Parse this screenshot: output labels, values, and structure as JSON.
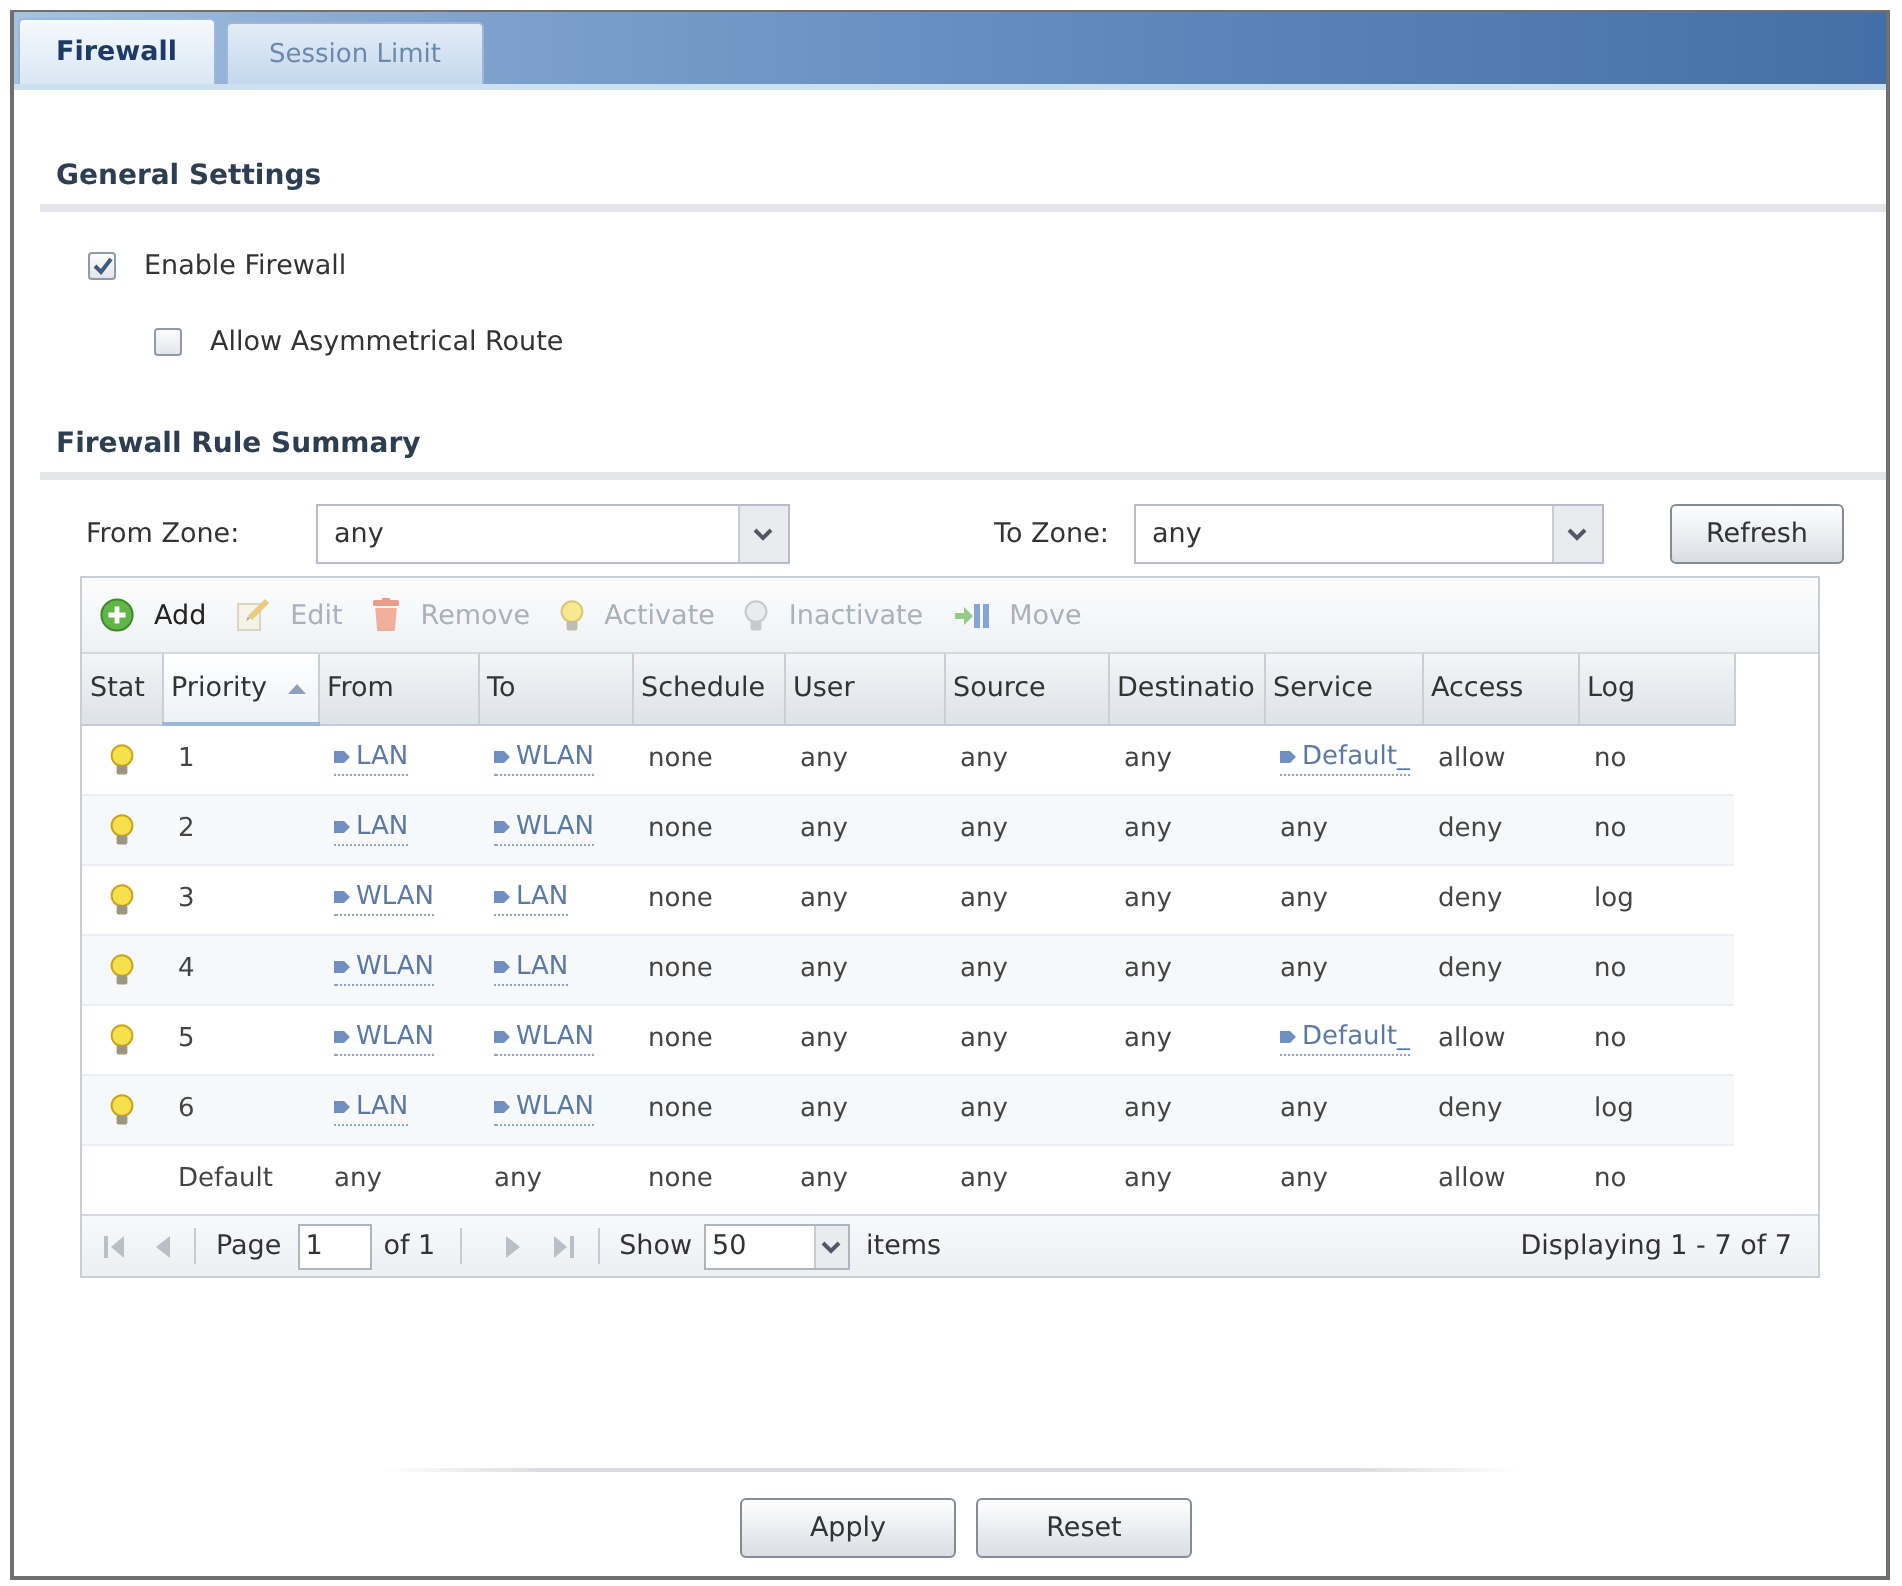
{
  "tabs": [
    {
      "label": "Firewall",
      "selected": true
    },
    {
      "label": "Session Limit",
      "selected": false
    }
  ],
  "general_settings": {
    "title": "General Settings",
    "options": [
      {
        "label": "Enable Firewall",
        "checked": true,
        "children": [
          {
            "label": "Allow Asymmetrical Route",
            "checked": false
          }
        ]
      }
    ]
  },
  "rule_summary": {
    "title": "Firewall Rule Summary",
    "from_zone": {
      "label": "From Zone:",
      "value": "any"
    },
    "to_zone": {
      "label": "To Zone:",
      "value": "any"
    },
    "refresh_button": "Refresh",
    "toolbar": [
      {
        "label": "Add",
        "disabled": false
      },
      {
        "label": "Edit",
        "disabled": true
      },
      {
        "label": "Remove",
        "disabled": true
      },
      {
        "label": "Activate",
        "disabled": true
      },
      {
        "label": "Inactivate",
        "disabled": true
      },
      {
        "label": "Move",
        "disabled": true
      }
    ],
    "table": {
      "columns": [
        {
          "label": "Stat",
          "sorted": false
        },
        {
          "label": "Priority",
          "sorted": true
        },
        {
          "label": "From",
          "sorted": false
        },
        {
          "label": "To",
          "sorted": false
        },
        {
          "label": "Schedule",
          "sorted": false
        },
        {
          "label": "User",
          "sorted": false
        },
        {
          "label": "Source",
          "sorted": false
        },
        {
          "label": "Destinatio",
          "sorted": false
        },
        {
          "label": "Service",
          "sorted": false
        },
        {
          "label": "Access",
          "sorted": false
        },
        {
          "label": "Log",
          "sorted": false
        }
      ],
      "rows": [
        {
          "cells": [
            {
              "kind": "status",
              "active": true
            },
            {
              "kind": "text",
              "text": "1"
            },
            {
              "kind": "object",
              "text": "LAN"
            },
            {
              "kind": "object",
              "text": "WLAN"
            },
            {
              "kind": "text",
              "text": "none"
            },
            {
              "kind": "text",
              "text": "any"
            },
            {
              "kind": "text",
              "text": "any"
            },
            {
              "kind": "text",
              "text": "any"
            },
            {
              "kind": "object",
              "text": "Default_"
            },
            {
              "kind": "text",
              "text": "allow"
            },
            {
              "kind": "text",
              "text": "no"
            }
          ]
        },
        {
          "cells": [
            {
              "kind": "status",
              "active": true
            },
            {
              "kind": "text",
              "text": "2"
            },
            {
              "kind": "object",
              "text": "LAN"
            },
            {
              "kind": "object",
              "text": "WLAN"
            },
            {
              "kind": "text",
              "text": "none"
            },
            {
              "kind": "text",
              "text": "any"
            },
            {
              "kind": "text",
              "text": "any"
            },
            {
              "kind": "text",
              "text": "any"
            },
            {
              "kind": "text",
              "text": "any"
            },
            {
              "kind": "text",
              "text": "deny"
            },
            {
              "kind": "text",
              "text": "no"
            }
          ]
        },
        {
          "cells": [
            {
              "kind": "status",
              "active": true
            },
            {
              "kind": "text",
              "text": "3"
            },
            {
              "kind": "object",
              "text": "WLAN"
            },
            {
              "kind": "object",
              "text": "LAN"
            },
            {
              "kind": "text",
              "text": "none"
            },
            {
              "kind": "text",
              "text": "any"
            },
            {
              "kind": "text",
              "text": "any"
            },
            {
              "kind": "text",
              "text": "any"
            },
            {
              "kind": "text",
              "text": "any"
            },
            {
              "kind": "text",
              "text": "deny"
            },
            {
              "kind": "text",
              "text": "log"
            }
          ]
        },
        {
          "cells": [
            {
              "kind": "status",
              "active": true
            },
            {
              "kind": "text",
              "text": "4"
            },
            {
              "kind": "object",
              "text": "WLAN"
            },
            {
              "kind": "object",
              "text": "LAN"
            },
            {
              "kind": "text",
              "text": "none"
            },
            {
              "kind": "text",
              "text": "any"
            },
            {
              "kind": "text",
              "text": "any"
            },
            {
              "kind": "text",
              "text": "any"
            },
            {
              "kind": "text",
              "text": "any"
            },
            {
              "kind": "text",
              "text": "deny"
            },
            {
              "kind": "text",
              "text": "no"
            }
          ]
        },
        {
          "cells": [
            {
              "kind": "status",
              "active": true
            },
            {
              "kind": "text",
              "text": "5"
            },
            {
              "kind": "object",
              "text": "WLAN"
            },
            {
              "kind": "object",
              "text": "WLAN"
            },
            {
              "kind": "text",
              "text": "none"
            },
            {
              "kind": "text",
              "text": "any"
            },
            {
              "kind": "text",
              "text": "any"
            },
            {
              "kind": "text",
              "text": "any"
            },
            {
              "kind": "object",
              "text": "Default_"
            },
            {
              "kind": "text",
              "text": "allow"
            },
            {
              "kind": "text",
              "text": "no"
            }
          ]
        },
        {
          "cells": [
            {
              "kind": "status",
              "active": true
            },
            {
              "kind": "text",
              "text": "6"
            },
            {
              "kind": "object",
              "text": "LAN"
            },
            {
              "kind": "object",
              "text": "WLAN"
            },
            {
              "kind": "text",
              "text": "none"
            },
            {
              "kind": "text",
              "text": "any"
            },
            {
              "kind": "text",
              "text": "any"
            },
            {
              "kind": "text",
              "text": "any"
            },
            {
              "kind": "text",
              "text": "any"
            },
            {
              "kind": "text",
              "text": "deny"
            },
            {
              "kind": "text",
              "text": "log"
            }
          ]
        },
        {
          "cells": [
            {
              "kind": "text",
              "text": ""
            },
            {
              "kind": "text",
              "text": "Default"
            },
            {
              "kind": "text",
              "text": "any"
            },
            {
              "kind": "text",
              "text": "any"
            },
            {
              "kind": "text",
              "text": "none"
            },
            {
              "kind": "text",
              "text": "any"
            },
            {
              "kind": "text",
              "text": "any"
            },
            {
              "kind": "text",
              "text": "any"
            },
            {
              "kind": "text",
              "text": "any"
            },
            {
              "kind": "text",
              "text": "allow"
            },
            {
              "kind": "text",
              "text": "no"
            }
          ]
        }
      ]
    },
    "pager": {
      "back_disabled": true,
      "forward_disabled": true,
      "page_label": "Page",
      "page": "1",
      "page_count": "of 1",
      "show_label": "Show",
      "page_size": "50",
      "items_label": "items",
      "summary": "Displaying 1 - 7 of 7"
    }
  },
  "buttons": [
    "Apply",
    "Reset"
  ]
}
